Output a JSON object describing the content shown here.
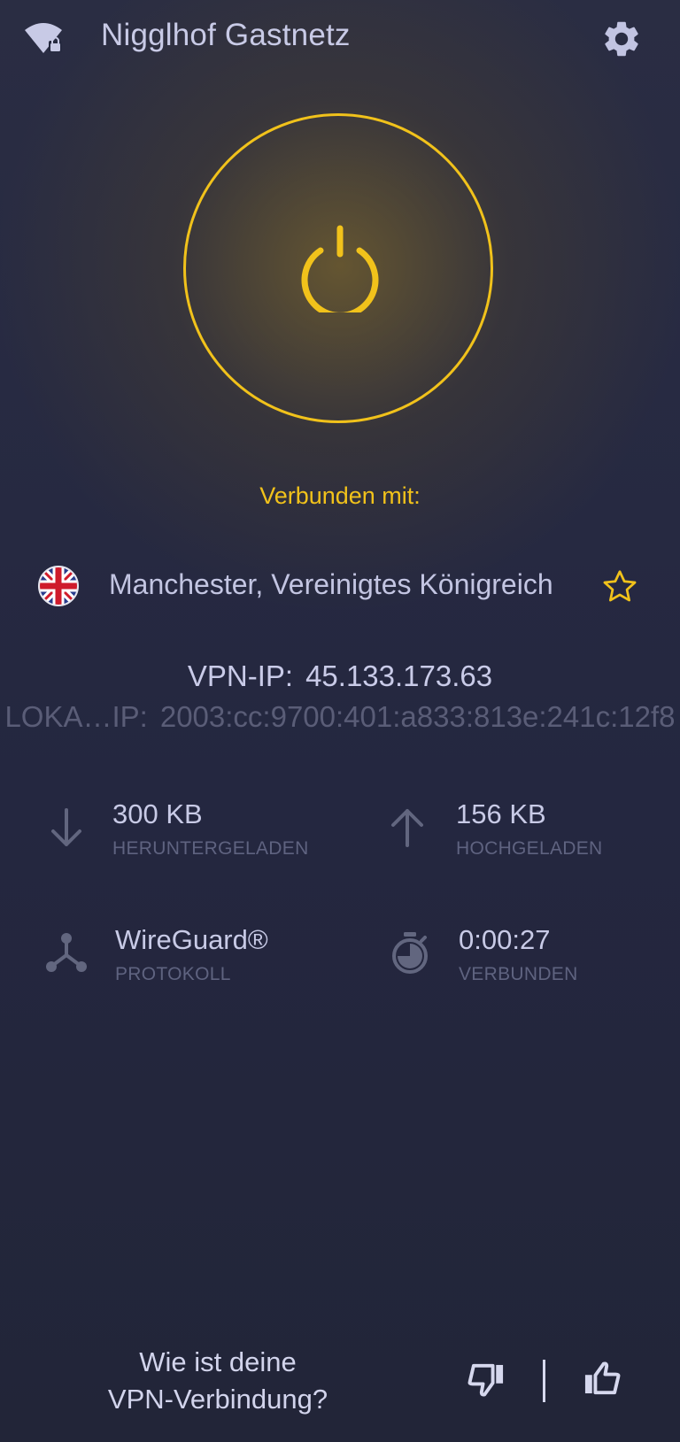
{
  "header": {
    "network_name": "Nigglhof Gastnetz",
    "wifi_icon": "wifi-lock-icon",
    "settings_icon": "gear-icon"
  },
  "connection": {
    "status_label": "Verbunden mit:",
    "power_icon": "power-icon",
    "accent_color": "#f1c21b"
  },
  "location": {
    "flag_icon": "uk-flag-icon",
    "name": "Manchester, Vereinigtes Königreich",
    "favorite_icon": "star-outline-icon"
  },
  "ip": {
    "vpn_label": "VPN-IP:",
    "vpn_value": "45.133.173.63",
    "local_label": "LOKA…IP:",
    "local_value": "2003:cc:9700:401:a833:813e:241c:12f8"
  },
  "stats": {
    "downloaded": {
      "value": "300 KB",
      "label": "HERUNTERGELADEN",
      "icon": "arrow-down-icon"
    },
    "uploaded": {
      "value": "156 KB",
      "label": "HOCHGELADEN",
      "icon": "arrow-up-icon"
    },
    "protocol": {
      "value": "WireGuard®",
      "label": "PROTOKOLL",
      "icon": "protocol-icon"
    },
    "duration": {
      "value": "0:00:27",
      "label": "VERBUNDEN",
      "icon": "timer-icon"
    }
  },
  "feedback": {
    "question_line1": "Wie ist deine",
    "question_line2": "VPN-Verbindung?",
    "thumbs_down_icon": "thumbs-down-icon",
    "thumbs_up_icon": "thumbs-up-icon"
  }
}
